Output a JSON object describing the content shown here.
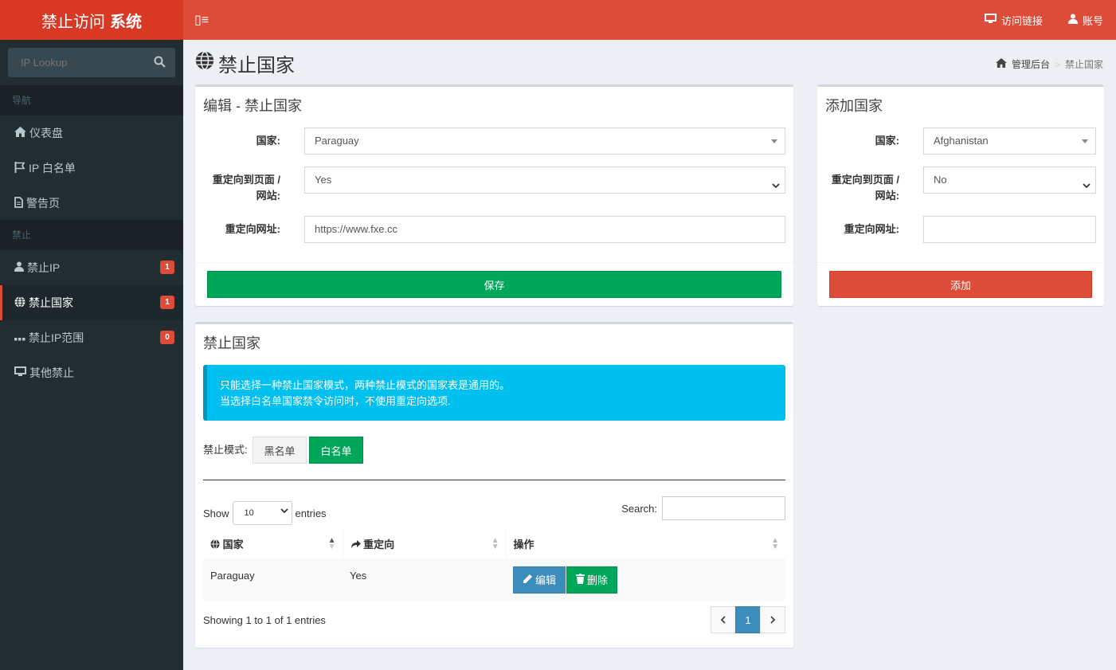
{
  "header": {
    "logo_regular": "禁止访问",
    "logo_bold": "系统",
    "toggle_label": "▯≡",
    "nav": {
      "links": "访问链接",
      "account": "账号"
    }
  },
  "sidebar": {
    "search_placeholder": "IP Lookup",
    "sections": [
      "导航",
      "禁止"
    ],
    "items": [
      {
        "label": "仪表盘"
      },
      {
        "label": "IP 白名单"
      },
      {
        "label": "警告页"
      },
      {
        "label": "禁止IP",
        "badge": "1"
      },
      {
        "label": "禁止国家",
        "badge": "1"
      },
      {
        "label": "禁止IP范围",
        "badge": "0"
      },
      {
        "label": "其他禁止"
      }
    ]
  },
  "page": {
    "title": "禁止国家",
    "breadcrumb": [
      "管理后台",
      "禁止国家"
    ]
  },
  "edit_box": {
    "title": "编辑 - 禁止国家",
    "country_label": "国家:",
    "country_value": "Paraguay",
    "redirect_label_1": "重定向到页面 /",
    "redirect_label_2": "网站:",
    "redirect_value": "Yes",
    "url_label": "重定向网址:",
    "url_value": "https://www.fxe.cc",
    "save_button": "保存"
  },
  "add_box": {
    "title": "添加国家",
    "country_label": "国家:",
    "country_value": "Afghanistan",
    "redirect_label_1": "重定向到页面 /",
    "redirect_label_2": "网站:",
    "redirect_value": "No",
    "url_label": "重定向网址:",
    "url_value": "",
    "add_button": "添加"
  },
  "list_box": {
    "title": "禁止国家",
    "callout_line1": "只能选择一种禁止国家模式，两种禁止模式的国家表是通用的。",
    "callout_line2": "当选择白名单国家禁令访问时，不使用重定向选项.",
    "mode_label": "禁止模式:",
    "mode_black": "黑名单",
    "mode_white": "白名单",
    "show_label": "Show",
    "show_value": "10",
    "entries_label": "entries",
    "search_label": "Search:",
    "columns": [
      "国家",
      "重定向",
      "操作"
    ],
    "rows": [
      {
        "country": "Paraguay",
        "redirect": "Yes"
      }
    ],
    "edit_button": "编辑",
    "delete_button": "删除",
    "info": "Showing 1 to 1 of 1 entries",
    "pager_current": "1"
  },
  "colors": {
    "header": "#dd4b39",
    "sidebar": "#222d32",
    "success": "#00a65a",
    "info": "#00c0ef",
    "primary": "#3c8dbc"
  }
}
